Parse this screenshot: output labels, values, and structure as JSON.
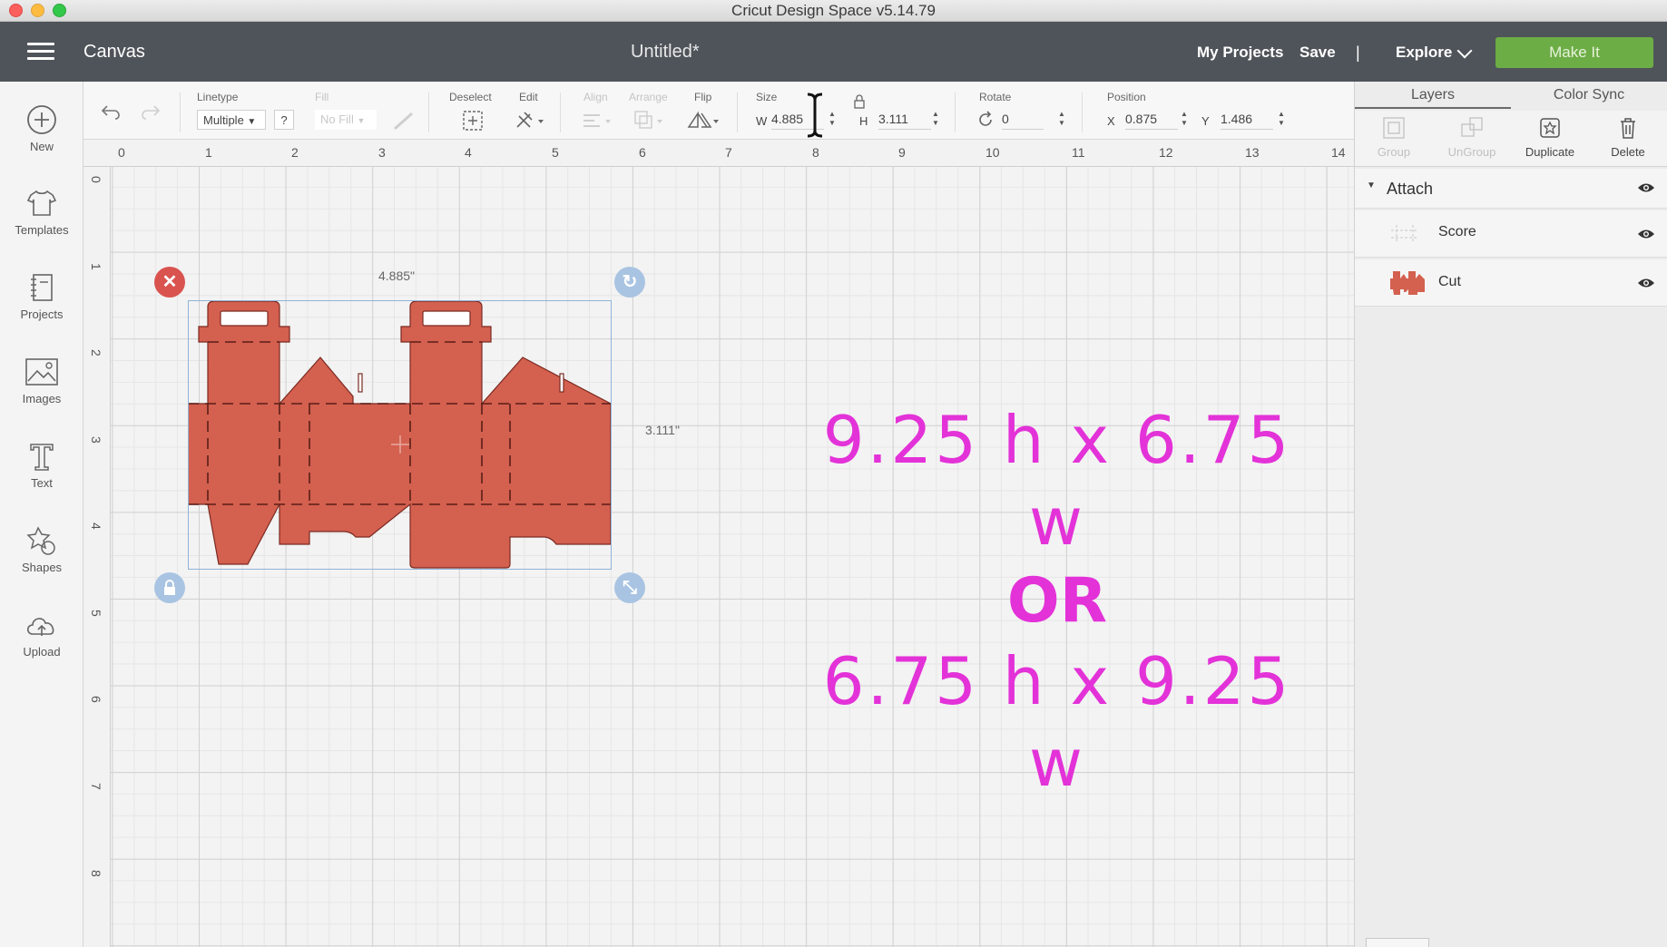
{
  "window": {
    "title": "Cricut Design Space  v5.14.79"
  },
  "header": {
    "section": "Canvas",
    "doc_title": "Untitled*",
    "my_projects": "My Projects",
    "save": "Save",
    "separator": "|",
    "explore": "Explore",
    "make_it": "Make It"
  },
  "sidebar": {
    "items": [
      {
        "label": "New",
        "icon": "plus-circle-icon"
      },
      {
        "label": "Templates",
        "icon": "tshirt-icon"
      },
      {
        "label": "Projects",
        "icon": "notebook-icon"
      },
      {
        "label": "Images",
        "icon": "image-icon"
      },
      {
        "label": "Text",
        "icon": "text-T-icon"
      },
      {
        "label": "Shapes",
        "icon": "shapes-icon"
      },
      {
        "label": "Upload",
        "icon": "cloud-upload-icon"
      }
    ]
  },
  "toolbar": {
    "linetype_label": "Linetype",
    "linetype_value": "Multiple",
    "help": "?",
    "fill_label": "Fill",
    "fill_value": "No Fill",
    "deselect_label": "Deselect",
    "edit_label": "Edit",
    "align_label": "Align",
    "arrange_label": "Arrange",
    "flip_label": "Flip",
    "size_label": "Size",
    "w_label": "W",
    "w_value": "4.885",
    "h_label": "H",
    "h_value": "3.111",
    "rotate_label": "Rotate",
    "rotate_value": "0",
    "position_label": "Position",
    "x_label": "X",
    "x_value": "0.875",
    "y_label": "Y",
    "y_value": "1.486"
  },
  "rulers": {
    "top": [
      "0",
      "1",
      "2",
      "3",
      "4",
      "5",
      "6",
      "7",
      "8",
      "9",
      "10",
      "11",
      "12",
      "13",
      "14"
    ],
    "left": [
      "0",
      "1",
      "2",
      "3",
      "4",
      "5",
      "6",
      "7",
      "8"
    ]
  },
  "canvas": {
    "width_dim": "4.885\"",
    "height_dim": "3.111\"",
    "shape_color": "#d4604f",
    "overlay": {
      "line1": "9.25 h x 6.75 w",
      "or": "OR",
      "line2": "6.75 h x 9.25 w",
      "color": "#e332d8"
    }
  },
  "layers_panel": {
    "tabs": [
      "Layers",
      "Color Sync"
    ],
    "tools": [
      "Group",
      "UnGroup",
      "Duplicate",
      "Delete"
    ],
    "attach_label": "Attach",
    "layers": [
      {
        "name": "Score"
      },
      {
        "name": "Cut"
      }
    ]
  },
  "colors": {
    "header_bg": "#4f545a",
    "make_it": "#6dad45",
    "accent_blue": "#a9c4e2"
  }
}
